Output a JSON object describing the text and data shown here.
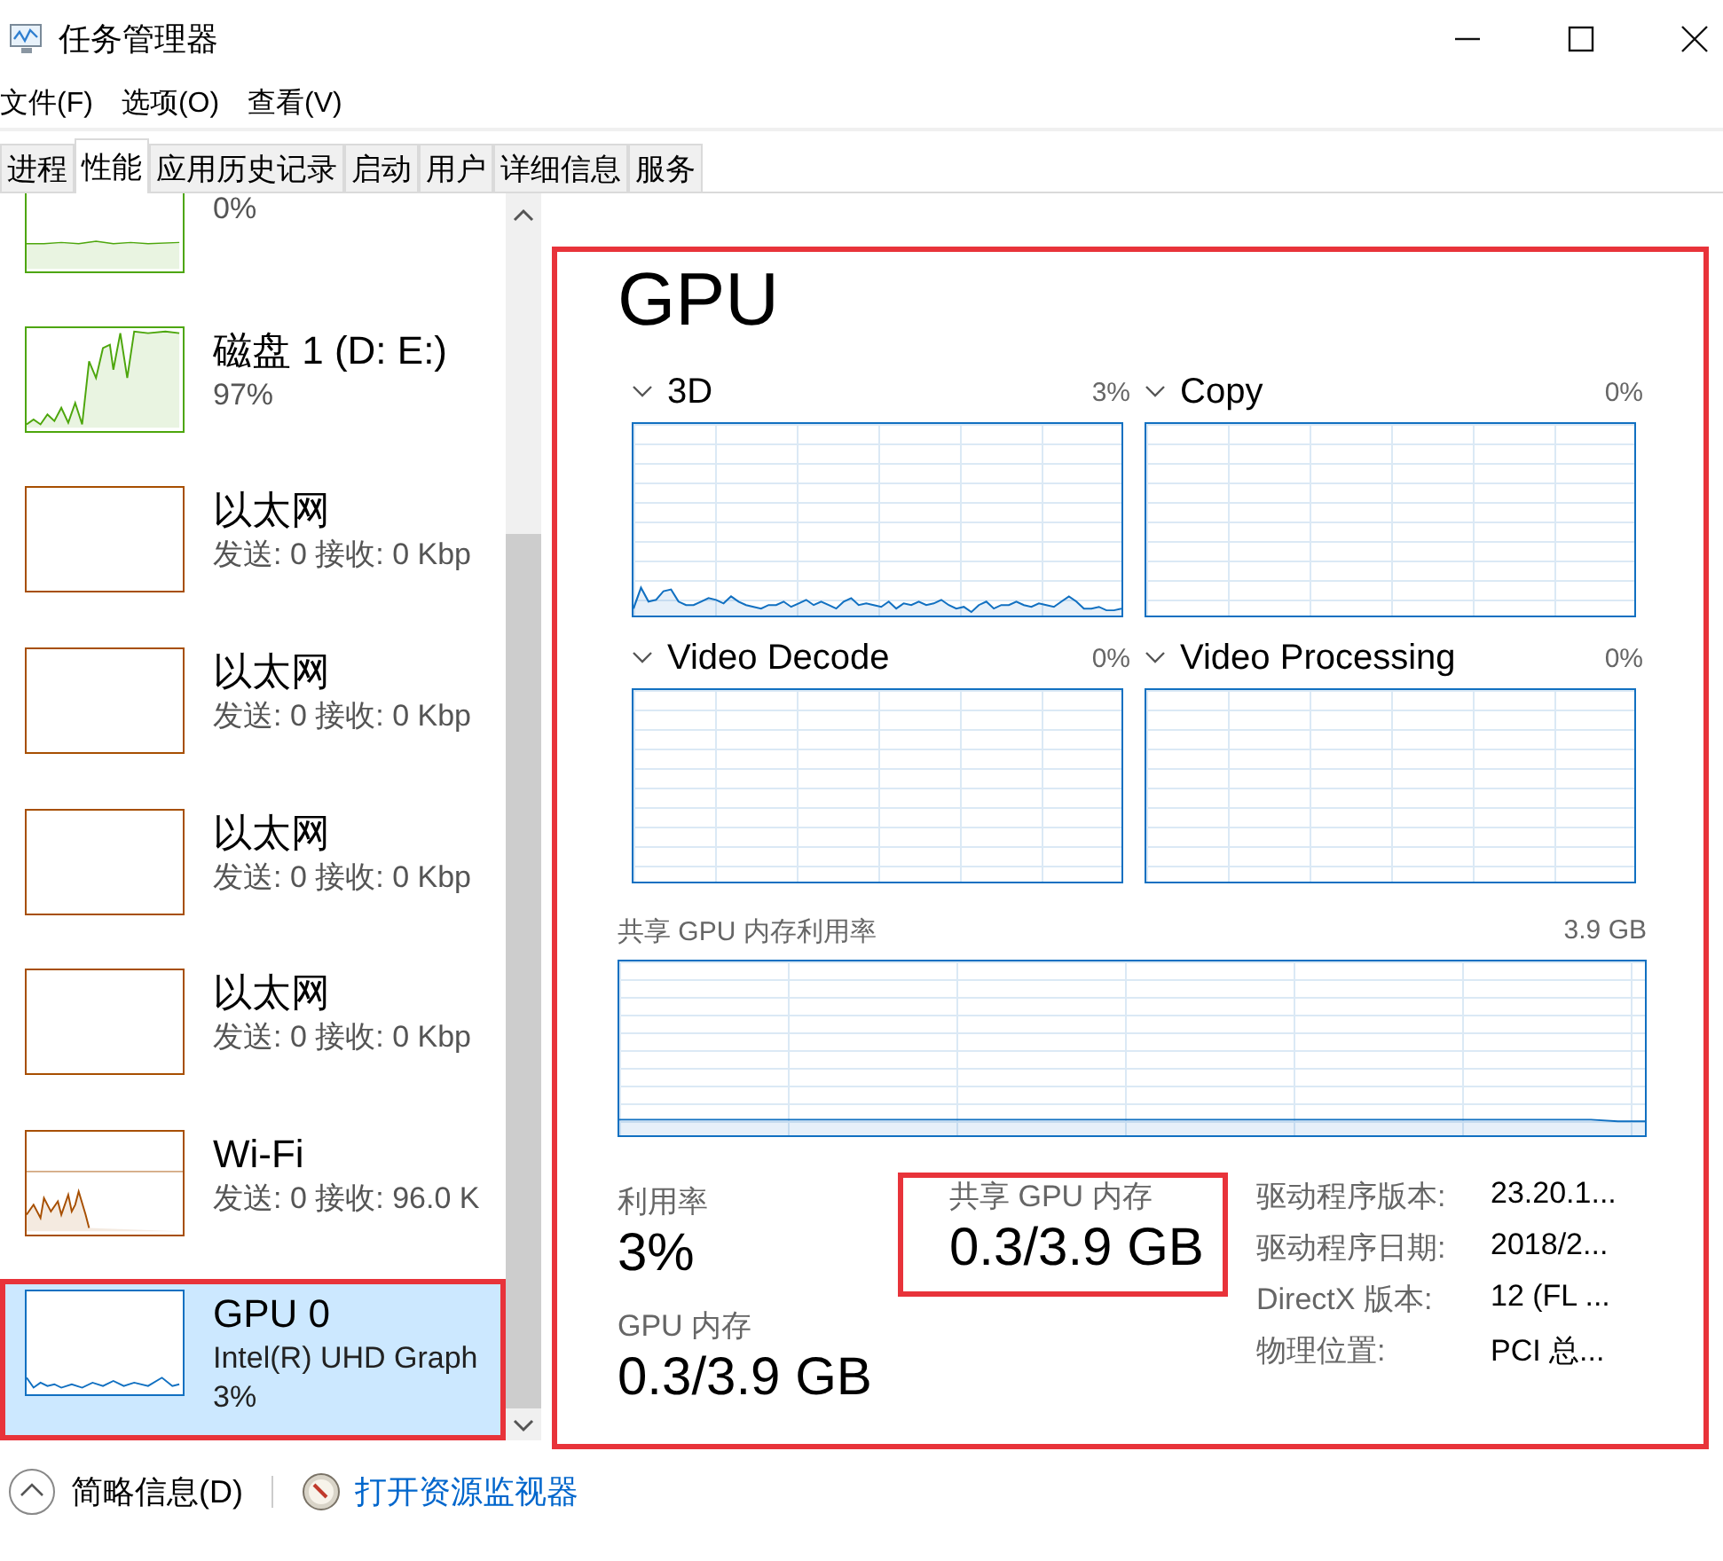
{
  "window": {
    "title": "任务管理器"
  },
  "menu": [
    "文件(F)",
    "选项(O)",
    "查看(V)"
  ],
  "tabs": [
    {
      "label": "进程",
      "selected": false
    },
    {
      "label": "性能",
      "selected": true
    },
    {
      "label": "应用历史记录",
      "selected": false
    },
    {
      "label": "启动",
      "selected": false
    },
    {
      "label": "用户",
      "selected": false
    },
    {
      "label": "详细信息",
      "selected": false
    },
    {
      "label": "服务",
      "selected": false
    }
  ],
  "sidebar": {
    "items": [
      {
        "kind": "cut",
        "stat": "0%",
        "color": "#4da60c",
        "selected": false,
        "highlighted": false
      },
      {
        "kind": "device",
        "name": "磁盘 1 (D: E:)",
        "stat": "97%",
        "color": "#4da60c",
        "selected": false,
        "highlighted": false
      },
      {
        "kind": "device",
        "name": "以太网",
        "detail": "发送: 0 接收: 0 Kbp",
        "color": "#a74f01",
        "selected": false,
        "highlighted": false
      },
      {
        "kind": "device",
        "name": "以太网",
        "detail": "发送: 0 接收: 0 Kbp",
        "color": "#a74f01",
        "selected": false,
        "highlighted": false
      },
      {
        "kind": "device",
        "name": "以太网",
        "detail": "发送: 0 接收: 0 Kbp",
        "color": "#a74f01",
        "selected": false,
        "highlighted": false
      },
      {
        "kind": "device",
        "name": "以太网",
        "detail": "发送: 0 接收: 0 Kbp",
        "color": "#a74f01",
        "selected": false,
        "highlighted": false
      },
      {
        "kind": "device",
        "name": "Wi-Fi",
        "detail": "发送: 0 接收: 96.0 K",
        "color": "#a74f01",
        "selected": false,
        "highlighted": false
      },
      {
        "kind": "device",
        "name": "GPU 0",
        "detail": "Intel(R) UHD Graph",
        "stat": "3%",
        "color": "#1170c1",
        "selected": true,
        "highlighted": true
      }
    ]
  },
  "main": {
    "title": "GPU",
    "highlighted": true,
    "engines": [
      {
        "name": "3D",
        "reading": "3%"
      },
      {
        "name": "Copy",
        "reading": "0%"
      },
      {
        "name": "Video Decode",
        "reading": "0%"
      },
      {
        "name": "Video Processing",
        "reading": "0%"
      }
    ],
    "shared_chart": {
      "label": "共享 GPU 内存利用率",
      "max": "3.9 GB"
    },
    "utilization": {
      "label": "利用率",
      "value": "3%"
    },
    "gpu_memory": {
      "label": "GPU 内存",
      "value": "0.3/3.9 GB"
    },
    "shared_memory": {
      "label": "共享 GPU 内存",
      "value": "0.3/3.9 GB",
      "highlighted": true
    },
    "details": [
      {
        "label": "驱动程序版本:",
        "value": "23.20.1..."
      },
      {
        "label": "驱动程序日期:",
        "value": "2018/2..."
      },
      {
        "label": "DirectX 版本:",
        "value": "12 (FL ..."
      },
      {
        "label": "物理位置:",
        "value": "PCI 总..."
      }
    ]
  },
  "footer": {
    "brief": "简略信息(D)",
    "monitor_link": "打开资源监视器"
  }
}
